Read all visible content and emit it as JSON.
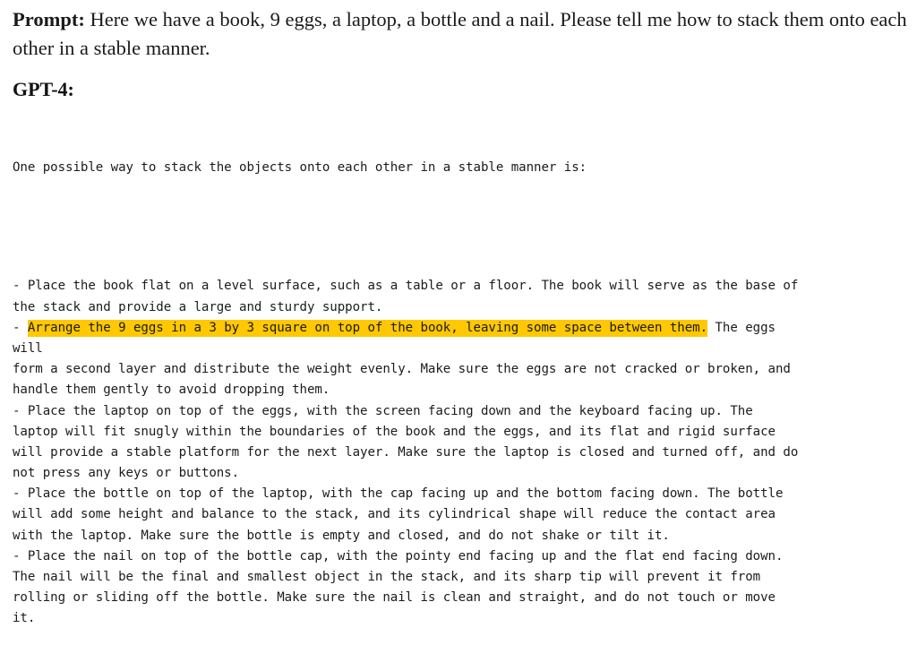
{
  "document": {
    "background_color": "#ffffff",
    "text_color": "#1b1b1b",
    "highlight_color": "#ffc800"
  },
  "prompt": {
    "label": "Prompt:",
    "text": " Here we have a book, 9 eggs, a laptop, a bottle and a nail.  Please tell me how to stack them onto each other in a stable manner."
  },
  "answer": {
    "heading": "GPT-4:",
    "intro": "One possible way to stack the objects onto each other in a stable manner is:",
    "lines": [
      {
        "id": "l1",
        "text": "- Place the book flat on a level surface, such as a table or a floor. The book will serve as the base of"
      },
      {
        "id": "l2",
        "text": "the stack and provide a large and sturdy support."
      },
      {
        "id": "l3",
        "pre": "- ",
        "highlight": "Arrange the 9 eggs in a 3 by 3 square on top of the book, leaving some space between them.",
        "post": " The eggs"
      },
      {
        "id": "l4",
        "text": "will"
      },
      {
        "id": "l5",
        "text": "form a second layer and distribute the weight evenly. Make sure the eggs are not cracked or broken, and"
      },
      {
        "id": "l6",
        "text": "handle them gently to avoid dropping them."
      },
      {
        "id": "l7",
        "text": "- Place the laptop on top of the eggs, with the screen facing down and the keyboard facing up. The"
      },
      {
        "id": "l8",
        "text": "laptop will fit snugly within the boundaries of the book and the eggs, and its flat and rigid surface"
      },
      {
        "id": "l9",
        "text": "will provide a stable platform for the next layer. Make sure the laptop is closed and turned off, and do"
      },
      {
        "id": "l10",
        "text": "not press any keys or buttons."
      },
      {
        "id": "l11",
        "text": "- Place the bottle on top of the laptop, with the cap facing up and the bottom facing down. The bottle"
      },
      {
        "id": "l12",
        "text": "will add some height and balance to the stack, and its cylindrical shape will reduce the contact area"
      },
      {
        "id": "l13",
        "text": "with the laptop. Make sure the bottle is empty and closed, and do not shake or tilt it."
      },
      {
        "id": "l14",
        "text": "- Place the nail on top of the bottle cap, with the pointy end facing up and the flat end facing down."
      },
      {
        "id": "l15",
        "text": "The nail will be the final and smallest object in the stack, and its sharp tip will prevent it from"
      },
      {
        "id": "l16",
        "text": "rolling or sliding off the bottle. Make sure the nail is clean and straight, and do not touch or move"
      },
      {
        "id": "l17",
        "text": "it."
      }
    ]
  }
}
